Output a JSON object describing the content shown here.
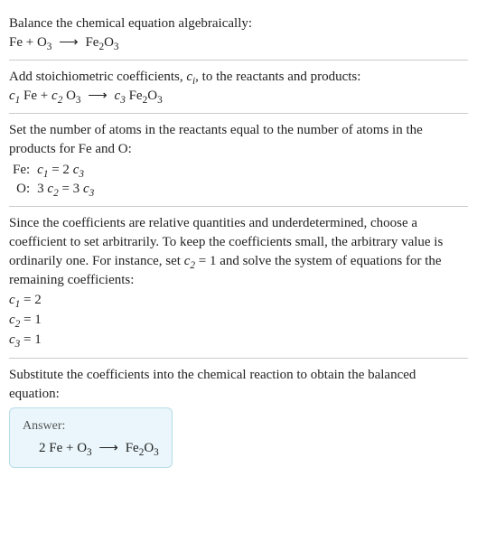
{
  "section1": {
    "intro": "Balance the chemical equation algebraically:",
    "eq": "Fe + O₃  ⟶  Fe₂O₃"
  },
  "section2": {
    "intro_a": "Add stoichiometric coefficients, ",
    "intro_b": ", to the reactants and products:",
    "ci": "cᵢ",
    "eq_c1": "c₁",
    "eq_fe": " Fe + ",
    "eq_c2": "c₂",
    "eq_o3": " O₃  ⟶  ",
    "eq_c3": "c₃",
    "eq_fe2o3": " Fe₂O₃"
  },
  "section3": {
    "intro": "Set the number of atoms in the reactants equal to the number of atoms in the products for Fe and O:",
    "rows": [
      {
        "label": "Fe:",
        "lhs": "c₁",
        "eq": " = 2 ",
        "rhs": "c₃"
      },
      {
        "label": "O:",
        "lhs": "3 c₂",
        "eq": " = 3 ",
        "rhs": "c₃"
      }
    ]
  },
  "section4": {
    "intro_a": "Since the coefficients are relative quantities and underdetermined, choose a coefficient to set arbitrarily. To keep the coefficients small, the arbitrary value is ordinarily one. For instance, set ",
    "intro_b": " = 1 and solve the system of equations for the remaining coefficients:",
    "c2": "c₂",
    "results": [
      {
        "c": "c₁",
        "val": " = 2"
      },
      {
        "c": "c₂",
        "val": " = 1"
      },
      {
        "c": "c₃",
        "val": " = 1"
      }
    ]
  },
  "section5": {
    "intro": "Substitute the coefficients into the chemical reaction to obtain the balanced equation:",
    "answer_label": "Answer:",
    "answer_eq": "2 Fe + O₃  ⟶  Fe₂O₃"
  }
}
